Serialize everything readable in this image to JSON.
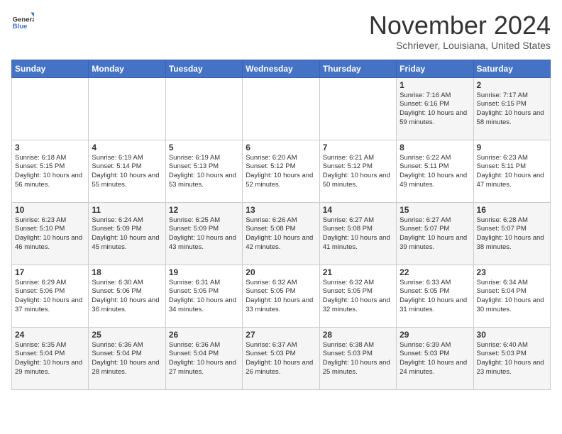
{
  "header": {
    "logo_line1": "General",
    "logo_line2": "Blue",
    "month": "November 2024",
    "location": "Schriever, Louisiana, United States"
  },
  "weekdays": [
    "Sunday",
    "Monday",
    "Tuesday",
    "Wednesday",
    "Thursday",
    "Friday",
    "Saturday"
  ],
  "weeks": [
    [
      {
        "day": "",
        "info": ""
      },
      {
        "day": "",
        "info": ""
      },
      {
        "day": "",
        "info": ""
      },
      {
        "day": "",
        "info": ""
      },
      {
        "day": "",
        "info": ""
      },
      {
        "day": "1",
        "info": "Sunrise: 7:16 AM\nSunset: 6:16 PM\nDaylight: 10 hours and 59 minutes."
      },
      {
        "day": "2",
        "info": "Sunrise: 7:17 AM\nSunset: 6:15 PM\nDaylight: 10 hours and 58 minutes."
      }
    ],
    [
      {
        "day": "3",
        "info": "Sunrise: 6:18 AM\nSunset: 5:15 PM\nDaylight: 10 hours and 56 minutes."
      },
      {
        "day": "4",
        "info": "Sunrise: 6:19 AM\nSunset: 5:14 PM\nDaylight: 10 hours and 55 minutes."
      },
      {
        "day": "5",
        "info": "Sunrise: 6:19 AM\nSunset: 5:13 PM\nDaylight: 10 hours and 53 minutes."
      },
      {
        "day": "6",
        "info": "Sunrise: 6:20 AM\nSunset: 5:12 PM\nDaylight: 10 hours and 52 minutes."
      },
      {
        "day": "7",
        "info": "Sunrise: 6:21 AM\nSunset: 5:12 PM\nDaylight: 10 hours and 50 minutes."
      },
      {
        "day": "8",
        "info": "Sunrise: 6:22 AM\nSunset: 5:11 PM\nDaylight: 10 hours and 49 minutes."
      },
      {
        "day": "9",
        "info": "Sunrise: 6:23 AM\nSunset: 5:11 PM\nDaylight: 10 hours and 47 minutes."
      }
    ],
    [
      {
        "day": "10",
        "info": "Sunrise: 6:23 AM\nSunset: 5:10 PM\nDaylight: 10 hours and 46 minutes."
      },
      {
        "day": "11",
        "info": "Sunrise: 6:24 AM\nSunset: 5:09 PM\nDaylight: 10 hours and 45 minutes."
      },
      {
        "day": "12",
        "info": "Sunrise: 6:25 AM\nSunset: 5:09 PM\nDaylight: 10 hours and 43 minutes."
      },
      {
        "day": "13",
        "info": "Sunrise: 6:26 AM\nSunset: 5:08 PM\nDaylight: 10 hours and 42 minutes."
      },
      {
        "day": "14",
        "info": "Sunrise: 6:27 AM\nSunset: 5:08 PM\nDaylight: 10 hours and 41 minutes."
      },
      {
        "day": "15",
        "info": "Sunrise: 6:27 AM\nSunset: 5:07 PM\nDaylight: 10 hours and 39 minutes."
      },
      {
        "day": "16",
        "info": "Sunrise: 6:28 AM\nSunset: 5:07 PM\nDaylight: 10 hours and 38 minutes."
      }
    ],
    [
      {
        "day": "17",
        "info": "Sunrise: 6:29 AM\nSunset: 5:06 PM\nDaylight: 10 hours and 37 minutes."
      },
      {
        "day": "18",
        "info": "Sunrise: 6:30 AM\nSunset: 5:06 PM\nDaylight: 10 hours and 36 minutes."
      },
      {
        "day": "19",
        "info": "Sunrise: 6:31 AM\nSunset: 5:05 PM\nDaylight: 10 hours and 34 minutes."
      },
      {
        "day": "20",
        "info": "Sunrise: 6:32 AM\nSunset: 5:05 PM\nDaylight: 10 hours and 33 minutes."
      },
      {
        "day": "21",
        "info": "Sunrise: 6:32 AM\nSunset: 5:05 PM\nDaylight: 10 hours and 32 minutes."
      },
      {
        "day": "22",
        "info": "Sunrise: 6:33 AM\nSunset: 5:05 PM\nDaylight: 10 hours and 31 minutes."
      },
      {
        "day": "23",
        "info": "Sunrise: 6:34 AM\nSunset: 5:04 PM\nDaylight: 10 hours and 30 minutes."
      }
    ],
    [
      {
        "day": "24",
        "info": "Sunrise: 6:35 AM\nSunset: 5:04 PM\nDaylight: 10 hours and 29 minutes."
      },
      {
        "day": "25",
        "info": "Sunrise: 6:36 AM\nSunset: 5:04 PM\nDaylight: 10 hours and 28 minutes."
      },
      {
        "day": "26",
        "info": "Sunrise: 6:36 AM\nSunset: 5:04 PM\nDaylight: 10 hours and 27 minutes."
      },
      {
        "day": "27",
        "info": "Sunrise: 6:37 AM\nSunset: 5:03 PM\nDaylight: 10 hours and 26 minutes."
      },
      {
        "day": "28",
        "info": "Sunrise: 6:38 AM\nSunset: 5:03 PM\nDaylight: 10 hours and 25 minutes."
      },
      {
        "day": "29",
        "info": "Sunrise: 6:39 AM\nSunset: 5:03 PM\nDaylight: 10 hours and 24 minutes."
      },
      {
        "day": "30",
        "info": "Sunrise: 6:40 AM\nSunset: 5:03 PM\nDaylight: 10 hours and 23 minutes."
      }
    ]
  ]
}
